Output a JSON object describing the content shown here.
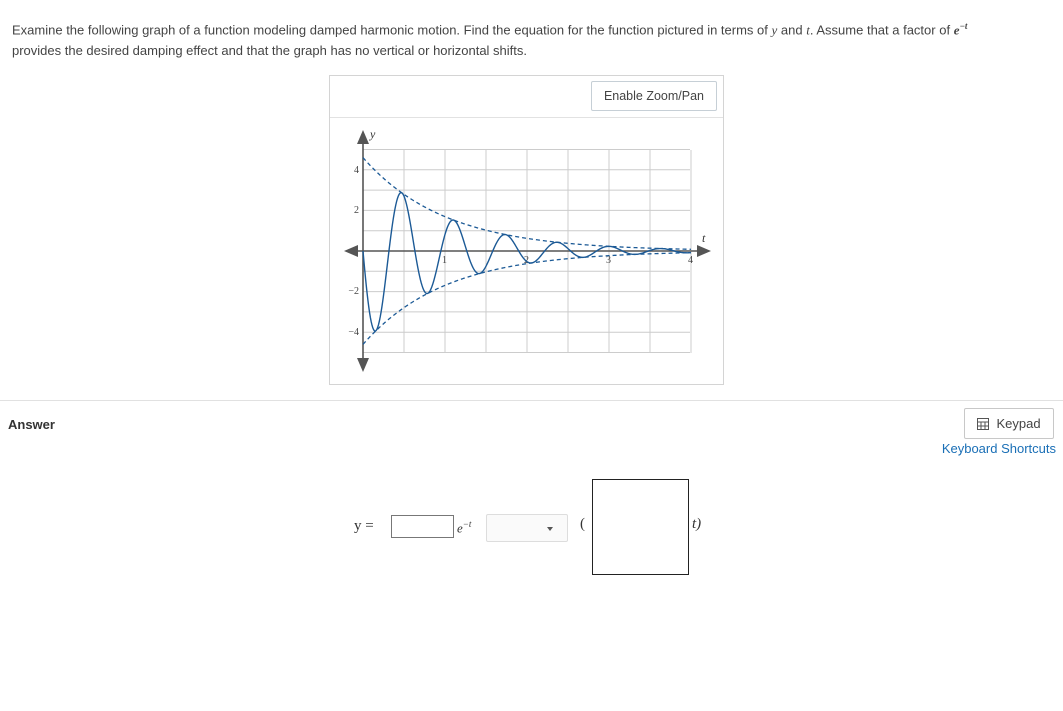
{
  "question": {
    "text_before": "Examine the following graph of a function modeling damped harmonic motion. Find the equation for the function pictured in terms of",
    "var_y": "y",
    "and": "and",
    "var_t": "t",
    "text_mid": ". Assume that a factor of",
    "factor_base": "e",
    "factor_exp": "−t",
    "text_after": "provides the desired damping effect and that the graph has no vertical or horizontal shifts."
  },
  "graph": {
    "zoom_button": "Enable Zoom/Pan",
    "x_axis_label": "t",
    "y_axis_label": "y",
    "x_ticks": [
      "1",
      "2",
      "3",
      "4"
    ],
    "y_ticks": [
      "4",
      "2",
      "−2",
      "−4"
    ],
    "colors": {
      "curve": "#1c5a96",
      "grid": "#cccccc",
      "axis": "#555555"
    }
  },
  "answer": {
    "label": "Answer",
    "keypad_label": "Keypad",
    "keypad_icon": "keypad-grid-icon",
    "shortcuts_link": "Keyboard Shortcuts",
    "equation": {
      "lhs": "y =",
      "exp_base": "e",
      "exp_power": "−t",
      "open_paren": "(",
      "close_paren": "t)"
    }
  }
}
